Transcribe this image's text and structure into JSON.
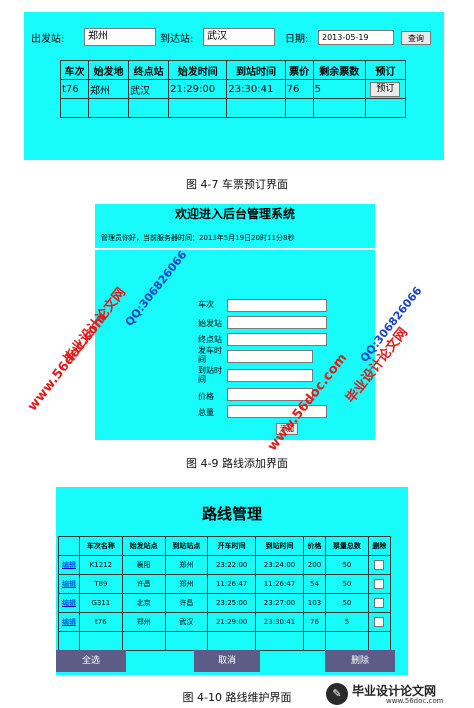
{
  "fig1": {
    "depart_label": "出发站:",
    "depart_value": "郑州",
    "arrive_label": "到达站:",
    "arrive_value": "武汉",
    "date_label": "日期:",
    "date_value": "2013-05-19",
    "query_label": "查询",
    "headers": [
      "车次",
      "始发地",
      "终点站",
      "始发时间",
      "到站时间",
      "票价",
      "剩余票数",
      "预订"
    ],
    "row": [
      "t76",
      "郑州",
      "武汉",
      "21:29:00",
      "23:30:41",
      "76",
      "5"
    ],
    "book_label": "预订",
    "caption": "图 4-7    车票预订界面"
  },
  "fig2": {
    "title": "欢迎进入后台管理系统",
    "info": "管理员你好，当前服务器时间：2013年5月19日20时11分8秒",
    "field_labels": [
      "车次",
      "始发站",
      "终点站",
      "发车时间",
      "到站时间",
      "价格",
      "总量"
    ],
    "add_label": "添加",
    "caption": "图 4-9    路线添加界面"
  },
  "fig3": {
    "title": "路线管理",
    "headers": [
      "",
      "车次名称",
      "始发站点",
      "到站站点",
      "开车时间",
      "到站时间",
      "价格",
      "票量总数",
      "删除"
    ],
    "rows": [
      {
        "edit": "编辑",
        "train": "K1212",
        "from": "襄阳",
        "to": "郑州",
        "dep": "23:22:00",
        "arr": "23:24:00",
        "price": "200",
        "total": "50"
      },
      {
        "edit": "编辑",
        "train": "T89",
        "from": "许昌",
        "to": "郑州",
        "dep": "11:26:47",
        "arr": "11:26:47",
        "price": "54",
        "total": "50"
      },
      {
        "edit": "编辑",
        "train": "G311",
        "from": "北京",
        "to": "许昌",
        "dep": "23:25:00",
        "arr": "23:27:00",
        "price": "103",
        "total": "50"
      },
      {
        "edit": "编辑",
        "train": "t76",
        "from": "郑州",
        "to": "武汉",
        "dep": "21:29:00",
        "arr": "23:30:41",
        "price": "76",
        "total": "5"
      }
    ],
    "select_all": "全选",
    "cancel": "取消",
    "delete": "删除",
    "caption": "图 4-10    路线维护界面"
  },
  "watermark": {
    "text1": "毕业设计论文网",
    "text2": "www.56doc.com",
    "text3": "QQ:306826066",
    "logo_text": "毕业设计论文网",
    "logo_url": "www.56doc.com"
  },
  "colors": {
    "panel": "#18fbfb",
    "bar": "#5c5c86",
    "watermark_red": "#e21b1b",
    "watermark_blue": "#1a3fc8"
  }
}
